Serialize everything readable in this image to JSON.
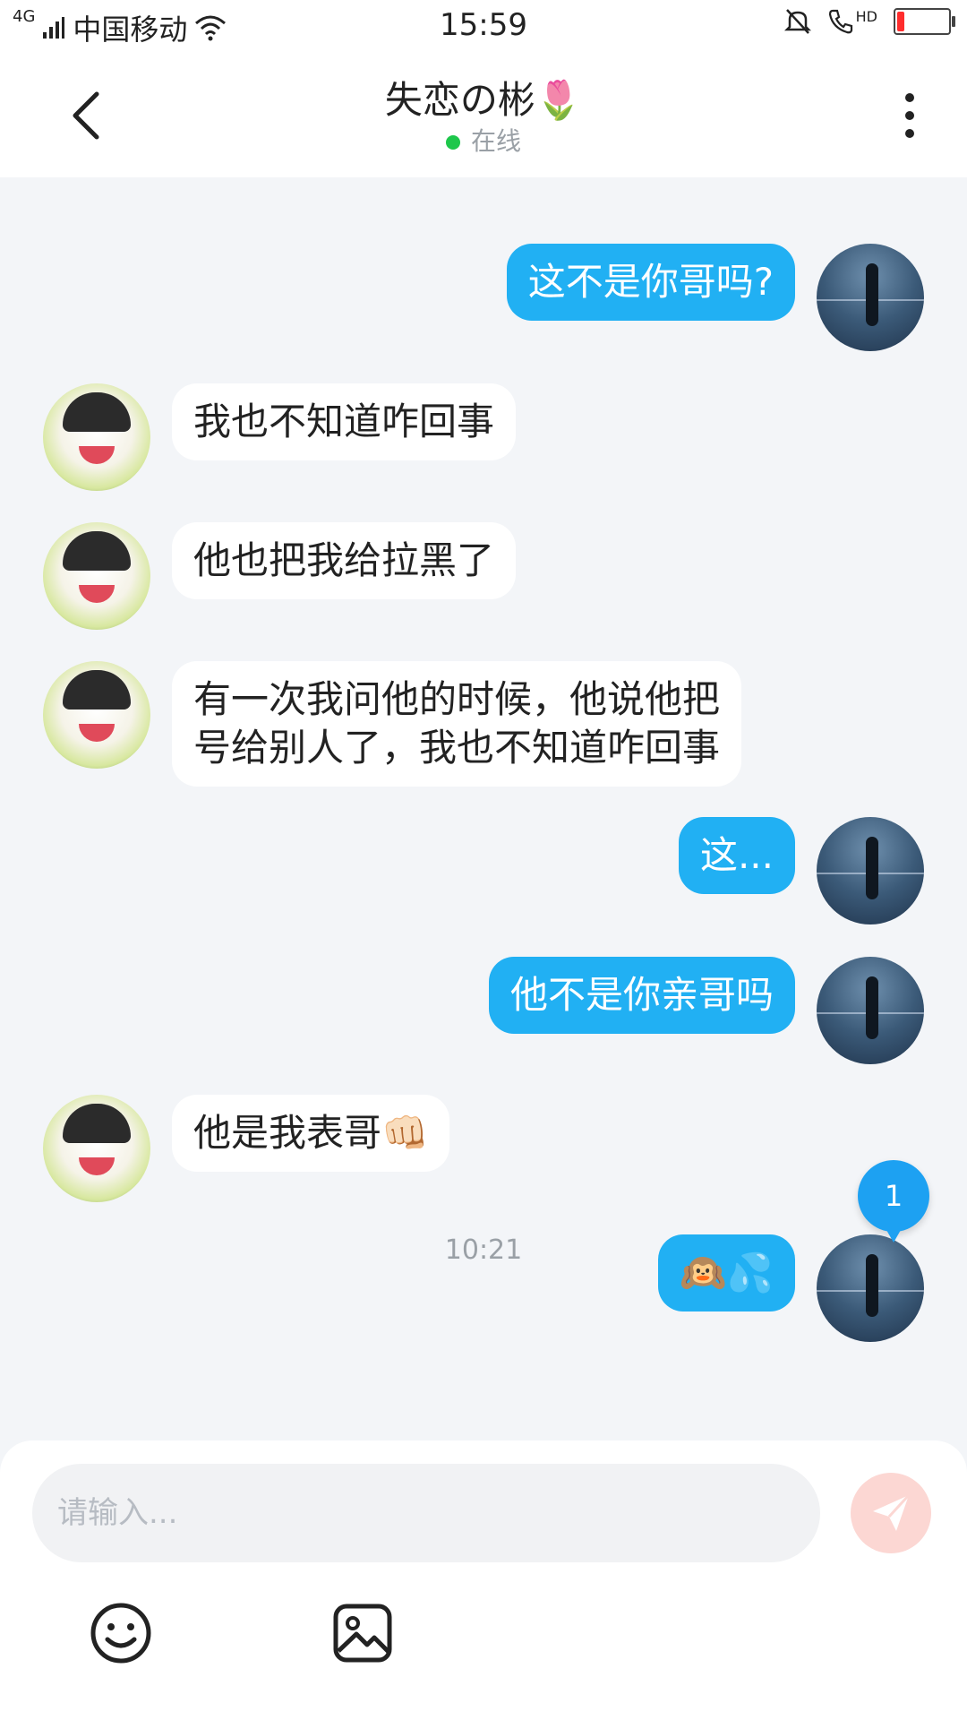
{
  "status_bar": {
    "network": "4G",
    "carrier": "中国移动",
    "time": "15:59",
    "hd_label": "HD",
    "battery_color": "#ff2d2d"
  },
  "header": {
    "title": "失恋の彬🌷",
    "status": "在线"
  },
  "messages": [
    {
      "from": "me",
      "text": "这不是你哥吗?"
    },
    {
      "from": "them",
      "text": "我也不知道咋回事"
    },
    {
      "from": "them",
      "text": "他也把我给拉黑了"
    },
    {
      "from": "them",
      "text": "有一次我问他的时候，他说他把\n号给别人了，我也不知道咋回事"
    },
    {
      "from": "me",
      "text": "这..."
    },
    {
      "from": "me",
      "text": "他不是你亲哥吗"
    },
    {
      "from": "them",
      "text": "他是我表哥👊🏻"
    },
    {
      "from": "me",
      "text": "🙉💦"
    }
  ],
  "timestamp": "10:21",
  "unread_count": "1",
  "composer": {
    "placeholder": "请输入..."
  },
  "colors": {
    "my_bubble": "#21b0f3",
    "their_bubble": "#ffffff",
    "online": "#1ec74b",
    "send_button": "#fcd7d3"
  }
}
